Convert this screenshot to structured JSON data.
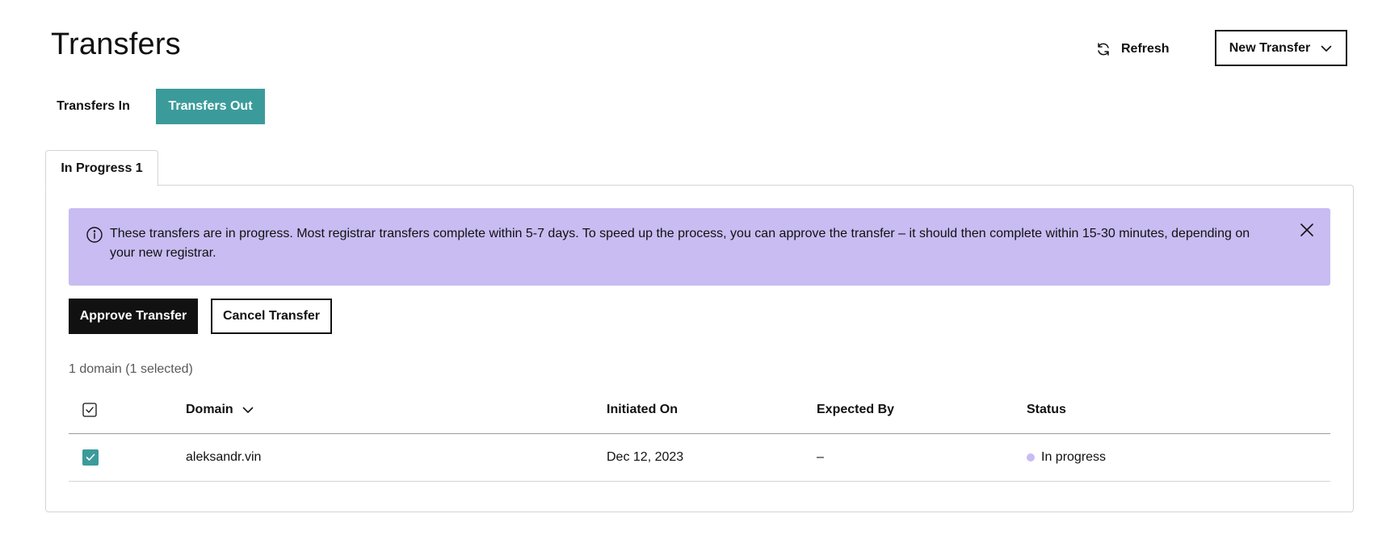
{
  "page": {
    "title": "Transfers"
  },
  "header": {
    "refresh_label": "Refresh",
    "new_transfer_label": "New Transfer"
  },
  "toggle": {
    "transfers_in": "Transfers In",
    "transfers_out": "Transfers Out",
    "active": "Transfers Out"
  },
  "subtab": {
    "label": "In Progress 1"
  },
  "alert": {
    "text": "These transfers are in progress. Most registrar transfers complete within 5-7 days. To speed up the process, you can approve the transfer – it should then complete within 15-30 minutes, depending on your new registrar.",
    "color": "#c8bcf2"
  },
  "actions": {
    "approve_label": "Approve Transfer",
    "cancel_label": "Cancel Transfer"
  },
  "summary": {
    "count_text": "1 domain (1 selected)"
  },
  "table": {
    "columns": {
      "domain": "Domain",
      "initiated": "Initiated On",
      "expected": "Expected By",
      "status": "Status"
    },
    "rows": [
      {
        "domain": "aleksandr.vin",
        "initiated": "Dec 12, 2023",
        "expected": "–",
        "status": "In progress",
        "selected": true
      }
    ]
  },
  "colors": {
    "accent_teal": "#3b9b9b",
    "alert_purple": "#c8bcf2",
    "primary_button": "#111111"
  },
  "icons": {
    "refresh": "refresh-icon",
    "new_transfer_chevron": "chevron-down-icon",
    "alert_info": "info-icon",
    "alert_close": "close-icon",
    "sort": "chevron-down-icon",
    "checkbox": "checkbox-checked-icon"
  }
}
